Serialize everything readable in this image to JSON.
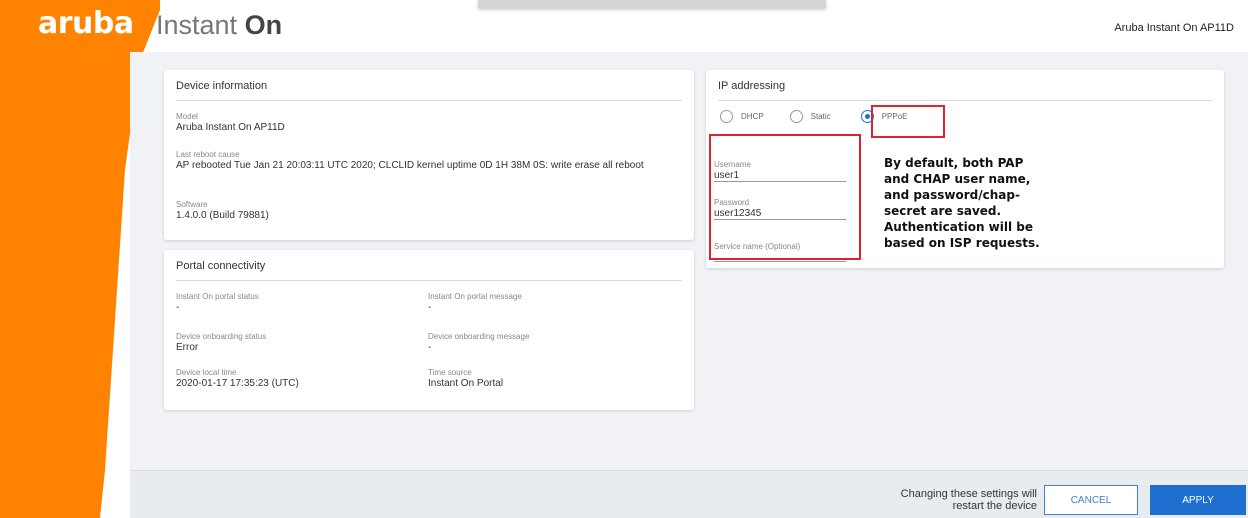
{
  "header": {
    "logo": "aruba",
    "product_prefix": "Instant ",
    "product_suffix": "On",
    "device_title": "Aruba Instant On AP11D"
  },
  "device_info": {
    "title": "Device information",
    "fields": [
      {
        "label": "Model",
        "value": "Aruba Instant On AP11D"
      },
      {
        "label": "Last reboot cause",
        "value": "AP rebooted Tue Jan 21 20:03:11 UTC 2020; CLCLID kernel uptime 0D 1H 38M 0S: write erase all reboot"
      },
      {
        "label": "Software",
        "value": "1.4.0.0 (Build 79881)"
      }
    ]
  },
  "portal": {
    "title": "Portal connectivity",
    "fields": [
      {
        "label": "Instant On portal status",
        "value": "-"
      },
      {
        "label": "Instant On portal message",
        "value": "-"
      },
      {
        "label": "Device onboarding status",
        "value": "Error"
      },
      {
        "label": "Device onboarding message",
        "value": "-"
      },
      {
        "label": "Device local time",
        "value": "2020-01-17 17:35:23 (UTC)"
      },
      {
        "label": "Time source",
        "value": "Instant On Portal"
      }
    ]
  },
  "ip": {
    "title": "IP addressing",
    "options": [
      {
        "label": "DHCP",
        "selected": false
      },
      {
        "label": "Static",
        "selected": false
      },
      {
        "label": "PPPoE",
        "selected": true
      }
    ],
    "username_label": "Username",
    "username_value": "user1",
    "password_label": "Password",
    "password_value": "user12345",
    "service_label": "Service name (Optional)",
    "service_value": ""
  },
  "annotation": {
    "text": "By default, both PAP and CHAP user name, and password/chap-secret are saved. Authentication will be based on ISP requests."
  },
  "footer": {
    "message": "Changing these settings will restart the device",
    "cancel_label": "CANCEL",
    "apply_label": "APPLY"
  },
  "colors": {
    "brand_orange": "#ff8300",
    "accent_blue": "#1f6fd1",
    "highlight_red": "#e0212e"
  }
}
